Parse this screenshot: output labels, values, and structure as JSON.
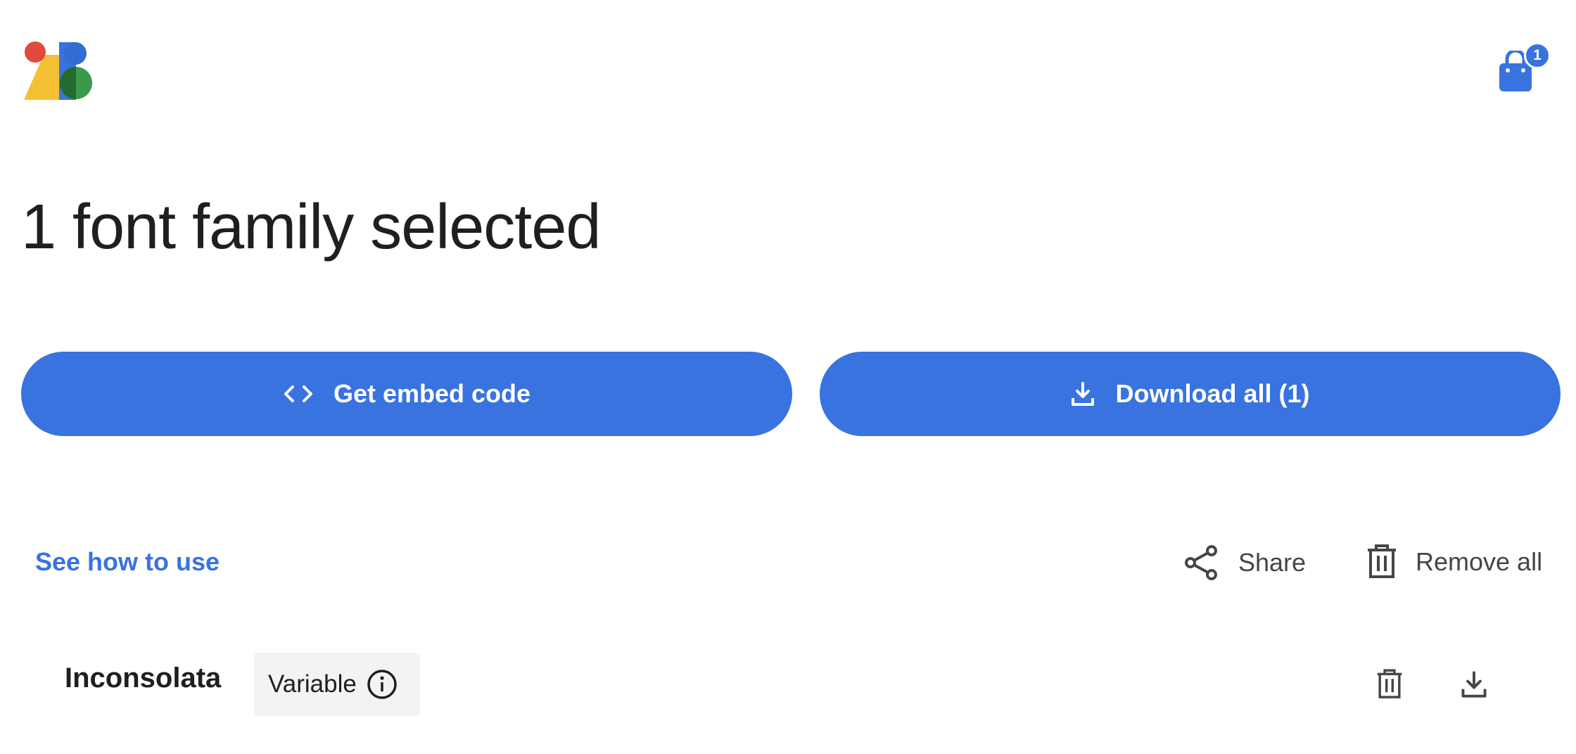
{
  "header": {
    "logo_icon": "google-fonts-logo-icon",
    "cart_icon": "shopping-bag-icon",
    "cart_count": "1"
  },
  "page_title": "1 font family selected",
  "buttons": {
    "embed_label": "Get embed code",
    "embed_icon": "code-brackets-icon",
    "download_label": "Download all (1)",
    "download_icon": "download-icon"
  },
  "actions": {
    "how_to_use": "See how to use",
    "share_label": "Share",
    "share_icon": "share-icon",
    "remove_all_label": "Remove all",
    "remove_all_icon": "trash-icon"
  },
  "fonts": [
    {
      "name": "Inconsolata",
      "chip_label": "Variable",
      "chip_icon": "info-icon",
      "remove_icon": "trash-icon",
      "download_icon": "download-icon"
    }
  ],
  "colors": {
    "accent": "#3873e0",
    "text": "#1f1f1f",
    "secondary_text": "#444746",
    "chip_bg": "#f1f3f4"
  }
}
